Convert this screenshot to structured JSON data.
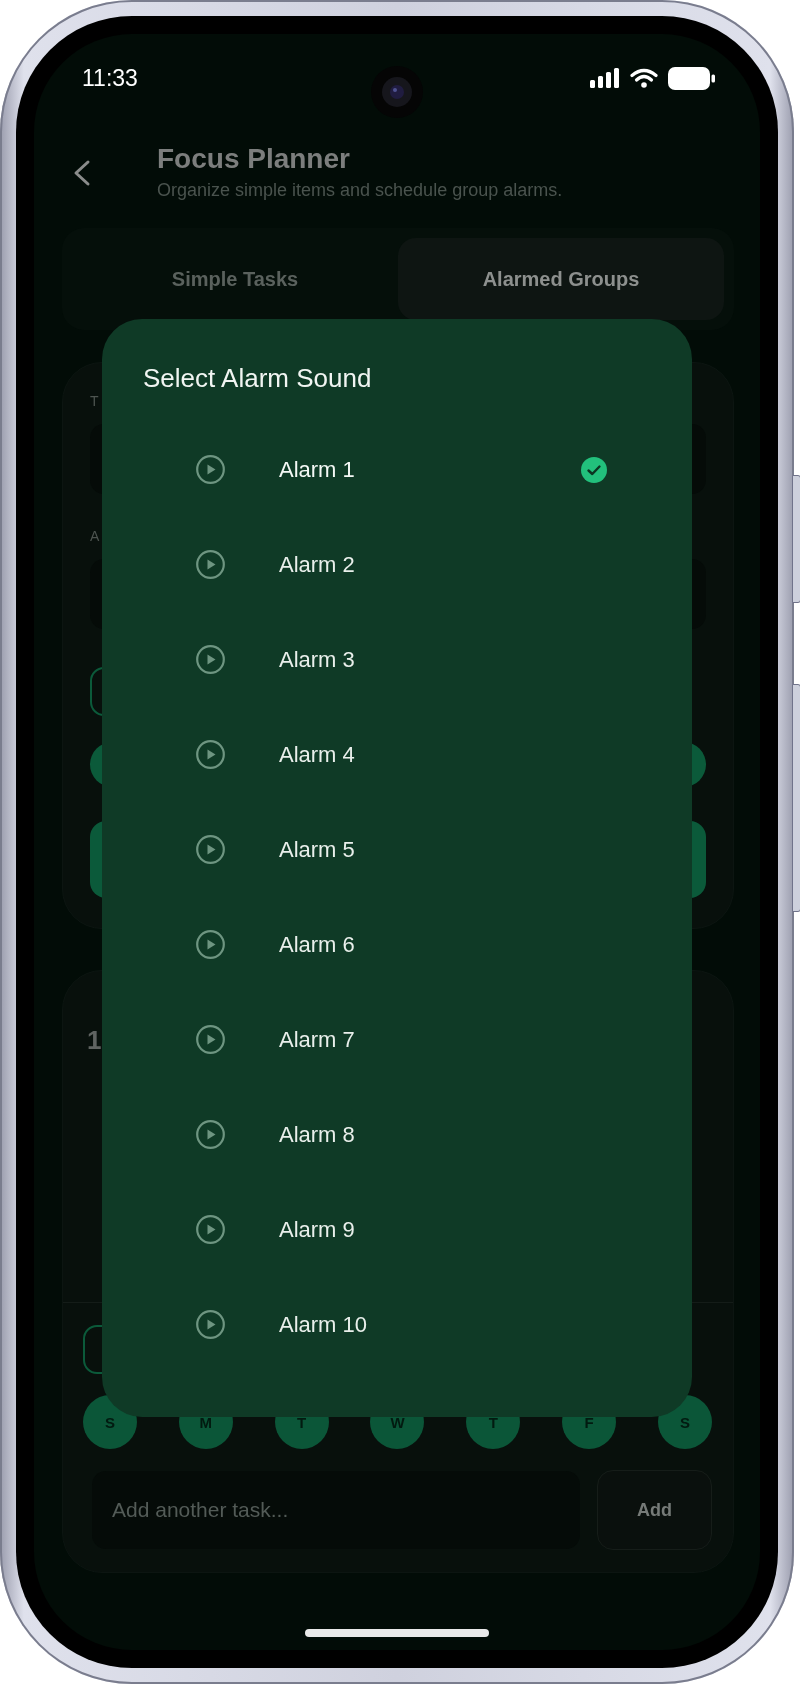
{
  "status_bar": {
    "time": "11:33"
  },
  "header": {
    "title": "Focus Planner",
    "subtitle": "Organize simple items and schedule group alarms."
  },
  "tabs": [
    {
      "label": "Simple Tasks",
      "selected": false
    },
    {
      "label": "Alarmed Groups",
      "selected": true
    }
  ],
  "group_form": {
    "fields": [
      {
        "label": "T"
      },
      {
        "label": "A"
      }
    ]
  },
  "group_card": {
    "heading": "1",
    "days": [
      {
        "label": "S"
      },
      {
        "label": "M"
      },
      {
        "label": "T"
      },
      {
        "label": "W"
      },
      {
        "label": "T"
      },
      {
        "label": "F"
      },
      {
        "label": "S"
      }
    ],
    "task_input": {
      "placeholder": "Add another task..."
    },
    "add_button": {
      "label": "Add"
    }
  },
  "sound_dialog": {
    "title": "Select Alarm Sound",
    "sounds": [
      {
        "name": "Alarm 1",
        "selected": true
      },
      {
        "name": "Alarm 2",
        "selected": false
      },
      {
        "name": "Alarm 3",
        "selected": false
      },
      {
        "name": "Alarm 4",
        "selected": false
      },
      {
        "name": "Alarm 5",
        "selected": false
      },
      {
        "name": "Alarm 6",
        "selected": false
      },
      {
        "name": "Alarm 7",
        "selected": false
      },
      {
        "name": "Alarm 8",
        "selected": false
      },
      {
        "name": "Alarm 9",
        "selected": false
      },
      {
        "name": "Alarm 10",
        "selected": false
      }
    ]
  }
}
